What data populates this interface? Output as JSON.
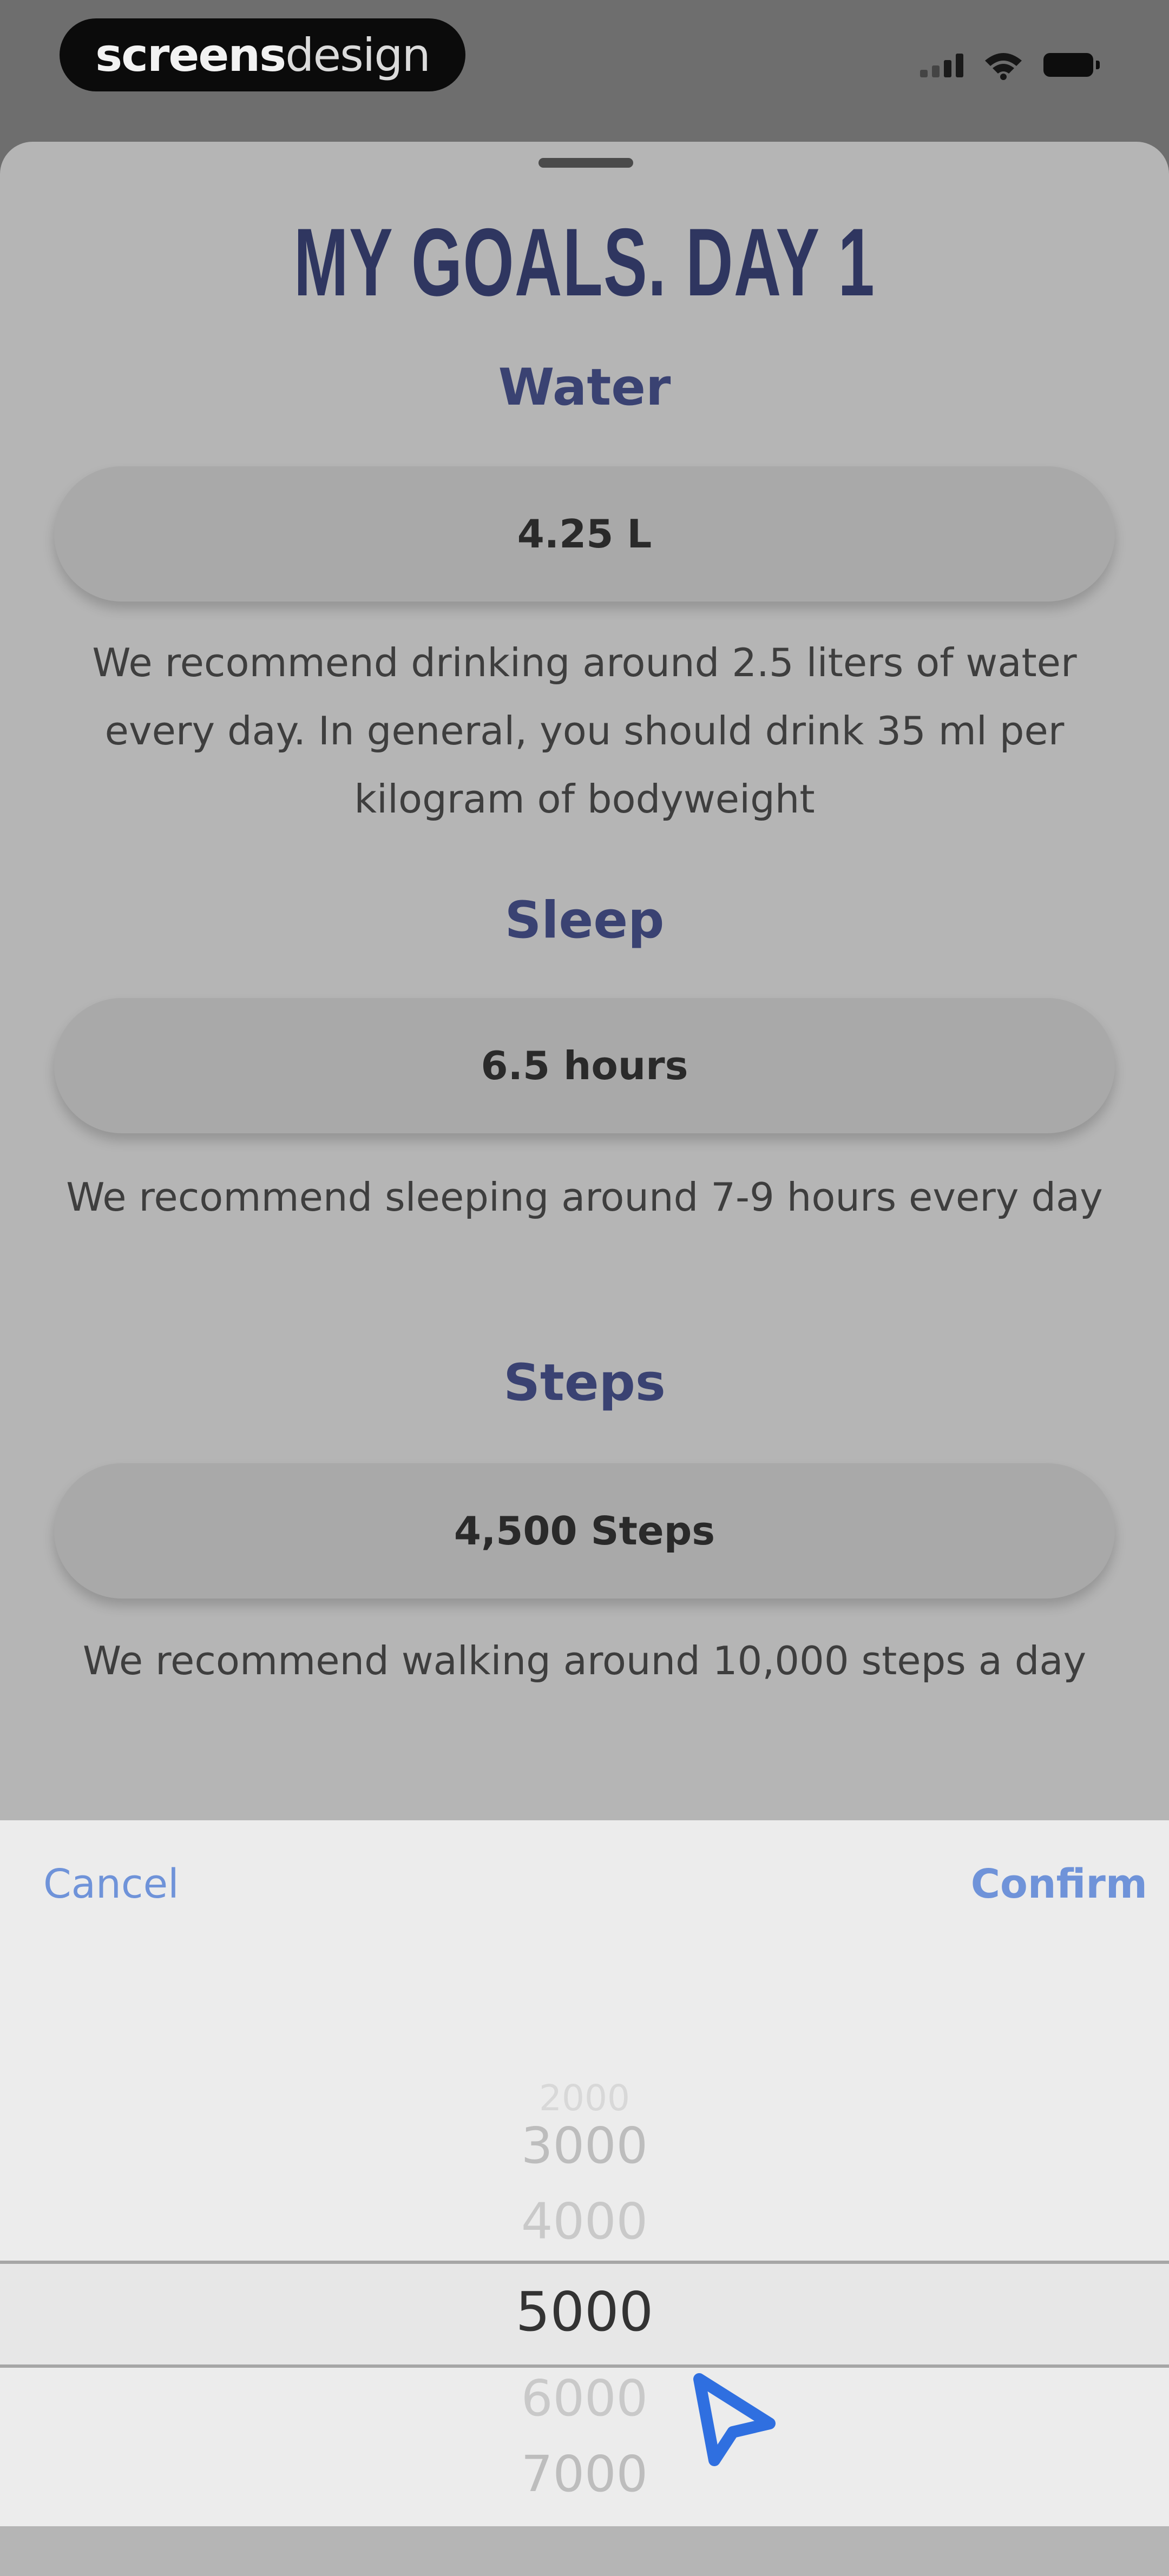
{
  "status_bar": {
    "brand": {
      "bold": "screens",
      "light": "design"
    },
    "icons": [
      "cellular-signal-icon",
      "wifi-icon",
      "battery-icon"
    ]
  },
  "sheet": {
    "title": "MY GOALS. DAY 1",
    "sections": [
      {
        "heading": "Water",
        "value": "4.25 L",
        "description": "We recommend drinking around 2.5 liters of water every day. In general, you should drink 35 ml per kilogram of bodyweight"
      },
      {
        "heading": "Sleep",
        "value": "6.5 hours",
        "description": "We recommend sleeping around 7-9 hours every day"
      },
      {
        "heading": "Steps",
        "value": "4,500 Steps",
        "description": "We recommend walking around 10,000 steps a day"
      }
    ]
  },
  "picker": {
    "cancel_label": "Cancel",
    "confirm_label": "Confirm",
    "options": [
      "2000",
      "3000",
      "4000",
      "5000",
      "6000",
      "7000"
    ],
    "selected": "5000"
  },
  "colors": {
    "title": "#2f3660",
    "section_heading": "#3a4272",
    "action": "#6f93d9",
    "sheet": "#b5b5b5",
    "picker": "#ececec"
  }
}
